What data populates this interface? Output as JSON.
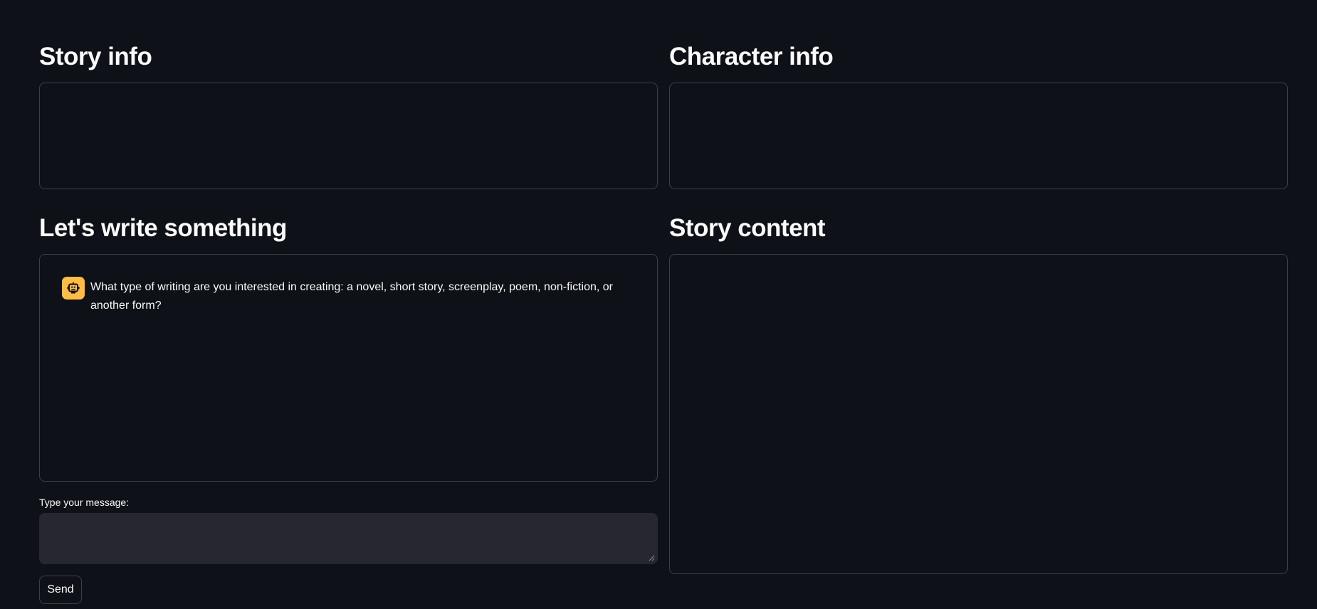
{
  "story_info": {
    "heading": "Story info"
  },
  "character_info": {
    "heading": "Character info"
  },
  "chat": {
    "heading": "Let's write something",
    "messages": [
      {
        "role": "assistant",
        "avatar_icon": "robot-icon",
        "avatar_color": "#ffbd45",
        "text": "What type of writing are you interested in creating: a novel, short story, screenplay, poem, non-fiction, or another form?"
      }
    ],
    "input_label": "Type your message:",
    "input_value": "",
    "send_label": "Send"
  },
  "story_content": {
    "heading": "Story content"
  },
  "theme": {
    "background": "#0e1117",
    "input_background": "#262730",
    "text": "#fafafa",
    "accent": "#ffbd45"
  }
}
